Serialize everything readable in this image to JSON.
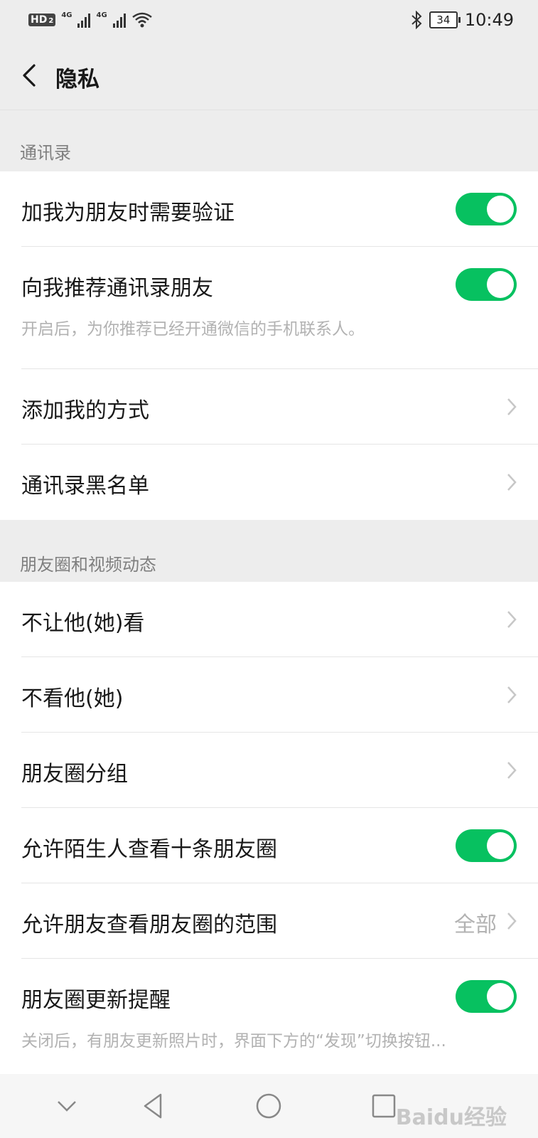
{
  "status_bar": {
    "hd_badge": "HD",
    "hd_sub": "2",
    "signal1_label": "4G",
    "signal2_label": "4G",
    "battery_level": "34",
    "time": "10:49"
  },
  "title_bar": {
    "title": "隐私"
  },
  "sections": [
    {
      "header": "通讯录",
      "rows": [
        {
          "label": "加我为朋友时需要验证",
          "toggle_on": true
        },
        {
          "label": "向我推荐通讯录朋友",
          "toggle_on": true,
          "description": "开启后，为你推荐已经开通微信的手机联系人。"
        },
        {
          "label": "添加我的方式"
        },
        {
          "label": "通讯录黑名单"
        }
      ]
    },
    {
      "header": "朋友圈和视频动态",
      "rows": [
        {
          "label": "不让他(她)看"
        },
        {
          "label": "不看他(她)"
        },
        {
          "label": "朋友圈分组"
        },
        {
          "label": "允许陌生人查看十条朋友圈",
          "toggle_on": true
        },
        {
          "label": "允许朋友查看朋友圈的范围",
          "value": "全部"
        },
        {
          "label": "朋友圈更新提醒",
          "toggle_on": true,
          "description": "关闭后，有朋友更新照片时，界面下方的“发现”切换按钮..."
        }
      ]
    }
  ],
  "watermark": "Baidu经验",
  "colors": {
    "accent_green": "#07c160",
    "background": "#ededed",
    "secondary_text": "#b2b2b2"
  },
  "icons": [
    "bluetooth-icon",
    "wifi-icon",
    "back-icon",
    "chevron-right-icon",
    "nav-collapse-icon",
    "nav-back-icon",
    "nav-home-icon",
    "nav-recents-icon"
  ]
}
